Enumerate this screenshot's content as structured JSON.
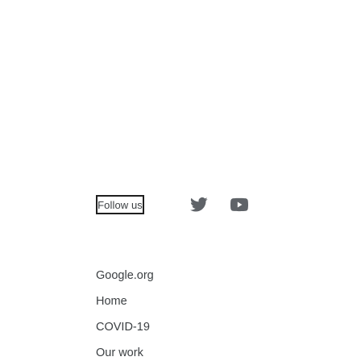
{
  "follow": {
    "label": "Follow us"
  },
  "social": {
    "twitter_icon": "twitter-icon",
    "youtube_icon": "youtube-icon",
    "icon_color": "#5f6368"
  },
  "footer": {
    "heading": "Google.org",
    "links": [
      {
        "label": "Home"
      },
      {
        "label": "COVID-19"
      },
      {
        "label": "Our work"
      }
    ]
  },
  "colors": {
    "text": "#3c4043",
    "background": "#ffffff"
  }
}
